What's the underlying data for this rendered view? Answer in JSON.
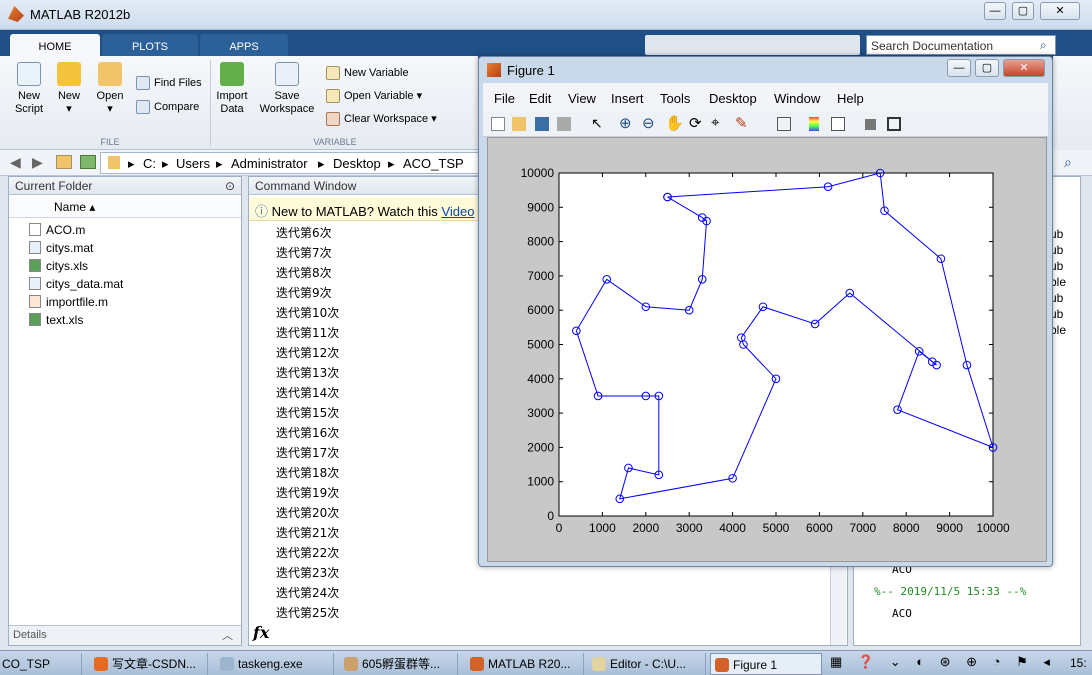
{
  "app": {
    "title": "MATLAB R2012b",
    "search_placeholder": "Search Documentation"
  },
  "ribbon": {
    "tabs": [
      "HOME",
      "PLOTS",
      "APPS"
    ],
    "buttons": {
      "new_script": "New\nScript",
      "new": "New",
      "open": "Open",
      "find_files": "Find Files",
      "compare": "Compare",
      "import_data": "Import\nData",
      "save_workspace": "Save\nWorkspace",
      "new_variable": "New Variable",
      "open_variable": "Open Variable",
      "clear_workspace": "Clear Workspace"
    },
    "groups": {
      "file": "FILE",
      "variable": "VARIABLE"
    }
  },
  "path": {
    "crumbs": [
      "C:",
      "Users",
      "Administrator",
      "Desktop",
      "ACO_TSP"
    ]
  },
  "current_folder": {
    "title": "Current Folder",
    "column": "Name",
    "files": [
      "ACO.m",
      "citys.mat",
      "citys.xls",
      "citys_data.mat",
      "importfile.m",
      "text.xls"
    ],
    "details": "Details"
  },
  "command_window": {
    "title": "Command Window",
    "banner": "New to MATLAB? Watch this",
    "banner_link": "Video",
    "prompt": "fx",
    "lines": [
      "迭代第6次",
      "迭代第7次",
      "迭代第8次",
      "迭代第9次",
      "迭代第10次",
      "迭代第11次",
      "迭代第12次",
      "迭代第13次",
      "迭代第14次",
      "迭代第15次",
      "迭代第16次",
      "迭代第17次",
      "迭代第18次",
      "迭代第19次",
      "迭代第20次",
      "迭代第21次",
      "迭代第22次",
      "迭代第23次",
      "迭代第24次",
      "迭代第25次"
    ]
  },
  "history": {
    "items": [
      "ACO",
      "%-- 2019/11/5 15:33 --%",
      "ACO"
    ],
    "partial": [
      "ub",
      "ub",
      "ub",
      "ble",
      "ub",
      "ub",
      "ble"
    ]
  },
  "figure": {
    "title": "Figure 1",
    "menus": [
      "File",
      "Edit",
      "View",
      "Insert",
      "Tools",
      "Desktop",
      "Window",
      "Help"
    ]
  },
  "chart_data": {
    "type": "line",
    "xlim": [
      0,
      10000
    ],
    "ylim": [
      0,
      10000
    ],
    "xticks": [
      "0",
      "1000",
      "2000",
      "3000",
      "4000",
      "5000",
      "6000",
      "7000",
      "8000",
      "9000",
      "10000"
    ],
    "yticks": [
      "0",
      "1000",
      "2000",
      "3000",
      "4000",
      "5000",
      "6000",
      "7000",
      "8000",
      "9000",
      "10000"
    ],
    "grid": false,
    "marker": "circle",
    "series_color": "#0000ff",
    "route": [
      [
        2500,
        9300
      ],
      [
        6200,
        9600
      ],
      [
        7400,
        10000
      ],
      [
        7500,
        8900
      ],
      [
        8800,
        7500
      ],
      [
        9400,
        4400
      ],
      [
        10000,
        2000
      ],
      [
        7800,
        3100
      ],
      [
        8300,
        4800
      ],
      [
        8600,
        4500
      ],
      [
        8700,
        4400
      ],
      [
        6700,
        6500
      ],
      [
        5900,
        5600
      ],
      [
        4700,
        6100
      ],
      [
        4200,
        5200
      ],
      [
        4250,
        5000
      ],
      [
        5000,
        4000
      ],
      [
        4000,
        1100
      ],
      [
        1400,
        500
      ],
      [
        1600,
        1400
      ],
      [
        2300,
        1200
      ],
      [
        2300,
        3500
      ],
      [
        2000,
        3500
      ],
      [
        900,
        3500
      ],
      [
        400,
        5400
      ],
      [
        1100,
        6900
      ],
      [
        2000,
        6100
      ],
      [
        3000,
        6000
      ],
      [
        3300,
        6900
      ],
      [
        3400,
        8600
      ],
      [
        3300,
        8700
      ],
      [
        2500,
        9300
      ]
    ]
  },
  "taskbar": {
    "items": [
      "CO_TSP",
      "写文章-CSDN...",
      "taskeng.exe",
      "605孵蛋群等...",
      "MATLAB R20...",
      "Editor - C:\\U...",
      "Figure 1"
    ],
    "clock": "15:"
  }
}
